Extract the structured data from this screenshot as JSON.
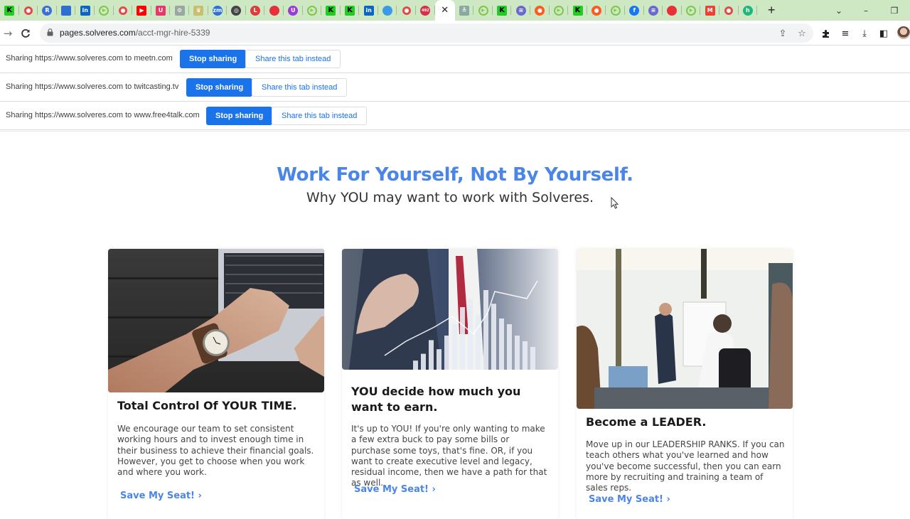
{
  "browser": {
    "tabs": [
      {
        "icon": "kickstarter-icon",
        "glyph": "K",
        "color": "#22cc22",
        "shape": "sq"
      },
      {
        "icon": "record-icon",
        "glyph": "",
        "color": "#e84848",
        "shape": "ring"
      },
      {
        "icon": "r-circle-icon",
        "glyph": "R",
        "color": "#3b6fd8",
        "shape": "circle"
      },
      {
        "icon": "screen-icon",
        "glyph": "",
        "color": "#2f6fd0",
        "shape": "sq"
      },
      {
        "icon": "linkedin-icon",
        "glyph": "in",
        "color": "#0a66c2",
        "shape": "sq"
      },
      {
        "icon": "rumble-icon",
        "glyph": "▶",
        "color": "#7ec74a",
        "shape": "play"
      },
      {
        "icon": "record-icon",
        "glyph": "",
        "color": "#e84848",
        "shape": "ring"
      },
      {
        "icon": "youtube-icon",
        "glyph": "▶",
        "color": "#ff0000",
        "shape": "sq"
      },
      {
        "icon": "u-icon",
        "glyph": "U",
        "color": "#e8386a",
        "shape": "sq"
      },
      {
        "icon": "gear-box-icon",
        "glyph": "⚙",
        "color": "#9aa6a0",
        "shape": "sq"
      },
      {
        "icon": "crown-icon",
        "glyph": "♛",
        "color": "#c8c070",
        "shape": "sq"
      },
      {
        "icon": "zoom-icon",
        "glyph": "zm",
        "color": "#2d6fd8",
        "shape": "circle"
      },
      {
        "icon": "chrome-icon",
        "glyph": "◎",
        "color": "#444444",
        "shape": "circle"
      },
      {
        "icon": "l-circle-icon",
        "glyph": "L",
        "color": "#e03a3a",
        "shape": "circle"
      },
      {
        "icon": "red-dot-icon",
        "glyph": "",
        "color": "#e8303a",
        "shape": "circle"
      },
      {
        "icon": "u-circle-icon",
        "glyph": "U",
        "color": "#9a3ad8",
        "shape": "circle"
      },
      {
        "icon": "rumble-icon",
        "glyph": "▶",
        "color": "#7ec74a",
        "shape": "play"
      },
      {
        "icon": "kickstarter-icon",
        "glyph": "K",
        "color": "#22cc22",
        "shape": "sq"
      },
      {
        "icon": "kickstarter-icon",
        "glyph": "K",
        "color": "#22cc22",
        "shape": "sq"
      },
      {
        "icon": "linkedin-icon",
        "glyph": "in",
        "color": "#0a66c2",
        "shape": "sq"
      },
      {
        "icon": "blue-swirl-icon",
        "glyph": "",
        "color": "#3a9ae8",
        "shape": "circle"
      },
      {
        "icon": "record-icon",
        "glyph": "",
        "color": "#e84848",
        "shape": "ring"
      },
      {
        "icon": "badge-492-icon",
        "glyph": "492",
        "color": "#d8304a",
        "shape": "circle"
      },
      {
        "icon": "close-icon",
        "glyph": "✕",
        "active": true
      },
      {
        "icon": "chevrons-icon",
        "glyph": "≚",
        "color": "#8aa8a0",
        "shape": "sq"
      },
      {
        "icon": "rumble-icon",
        "glyph": "▶",
        "color": "#7ec74a",
        "shape": "play"
      },
      {
        "icon": "kickstarter-icon",
        "glyph": "K",
        "color": "#22cc22",
        "shape": "sq"
      },
      {
        "icon": "podcast-icon",
        "glyph": "≡",
        "color": "#6a6ad0",
        "shape": "circle"
      },
      {
        "icon": "reddit-icon",
        "glyph": "●",
        "color": "#ff5a1f",
        "shape": "circle"
      },
      {
        "icon": "rumble-icon",
        "glyph": "▶",
        "color": "#7ec74a",
        "shape": "play"
      },
      {
        "icon": "kickstarter-icon",
        "glyph": "K",
        "color": "#22cc22",
        "shape": "sq"
      },
      {
        "icon": "reddit-icon",
        "glyph": "●",
        "color": "#ff5a1f",
        "shape": "circle"
      },
      {
        "icon": "rumble-icon",
        "glyph": "▶",
        "color": "#7ec74a",
        "shape": "play"
      },
      {
        "icon": "facebook-icon",
        "glyph": "f",
        "color": "#1877f2",
        "shape": "circle"
      },
      {
        "icon": "podcast-icon",
        "glyph": "≡",
        "color": "#6a6ad0",
        "shape": "circle"
      },
      {
        "icon": "red-dot-icon",
        "glyph": "",
        "color": "#e8303a",
        "shape": "circle"
      },
      {
        "icon": "rumble-icon",
        "glyph": "▶",
        "color": "#7ec74a",
        "shape": "play"
      },
      {
        "icon": "gmail-icon",
        "glyph": "M",
        "color": "#ea4335",
        "shape": "sq"
      },
      {
        "icon": "record-icon",
        "glyph": "",
        "color": "#e84848",
        "shape": "ring"
      },
      {
        "icon": "h-circle-icon",
        "glyph": "h",
        "color": "#1fb87a",
        "shape": "circle"
      }
    ],
    "new_tab": "+",
    "window_controls": {
      "tab_search": "⌄",
      "minimize": "–",
      "restore": "❐"
    },
    "nav": {
      "back": "→",
      "reload": "C"
    },
    "url_host": "pages.solveres.com",
    "url_path": "/acct-mgr-hire-5339",
    "toolbar_icons": {
      "share": "⇪",
      "bookmark": "☆",
      "extensions": "✚",
      "media": "≡",
      "download": "⤓",
      "sidepanel": "◧"
    }
  },
  "sharing_bars": [
    {
      "message": "Sharing https://www.solveres.com to meetn.com",
      "stop_label": "Stop sharing",
      "share_label": "Share this tab instead"
    },
    {
      "message": "Sharing https://www.solveres.com to twitcasting.tv",
      "stop_label": "Stop sharing",
      "share_label": "Share this tab instead"
    },
    {
      "message": "Sharing https://www.solveres.com to www.free4talk.com",
      "stop_label": "Stop sharing",
      "share_label": "Share this tab instead"
    }
  ],
  "page": {
    "headline": "Work For Yourself, Not By Yourself.",
    "subheadline": "Why YOU may want to work with Solveres.",
    "accent_color": "#4a86e8",
    "cards": [
      {
        "image_alt": "hand with wristwatch on laptop keyboard",
        "title": "Total Control Of YOUR TIME.",
        "body": "We encourage our team to set consistent working hours and to invest enough time in their business to achieve their financial goals. However, you get to choose when you work and where you work.",
        "cta": "Save My Seat! ›"
      },
      {
        "image_alt": "businessman drawing rising bar chart",
        "title": "YOU decide how much you want to earn.",
        "body": "It's up to YOU! If you're only wanting to make a few extra buck to pay some bills or purchase some toys, that's fine. OR, if you want to create executive level and legacy, residual income, then we have a path for that as well.",
        "cta": "Save My Seat! ›"
      },
      {
        "image_alt": "presenter at flipchart in meeting room",
        "title": "Become a LEADER.",
        "body": "Move up in our LEADERSHIP RANKS. If you can teach others what you've learned and how you've become successful, then you can earn more by recruiting and training a team of sales reps.",
        "cta": "Save My Seat! ›"
      }
    ]
  }
}
